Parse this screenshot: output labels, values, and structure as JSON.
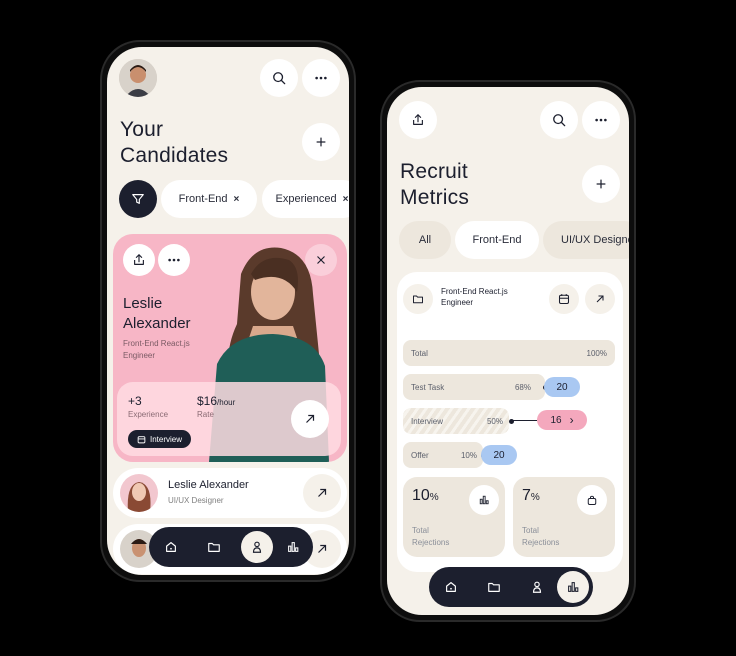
{
  "left": {
    "title_line1": "Your",
    "title_line2": "Candidates",
    "filters": [
      {
        "label": "Front-End",
        "close": "×"
      },
      {
        "label": "Experienced",
        "close": "×"
      }
    ],
    "featured": {
      "name_line1": "Leslie",
      "name_line2": "Alexander",
      "role_line1": "Front-End React.js",
      "role_line2": "Engineer",
      "experience_value": "+3",
      "experience_label": "Experience",
      "rate_value": "$16",
      "rate_unit": "/hour",
      "rate_label": "Rate",
      "status": "Interview"
    },
    "list": [
      {
        "name": "Leslie Alexander",
        "role": "UI/UX Designer"
      }
    ]
  },
  "right": {
    "title_line1": "Recruit",
    "title_line2": "Metrics",
    "tabs": [
      "All",
      "Front-End",
      "UI/UX Designer"
    ],
    "job_title_line1": "Front-End React.js",
    "job_title_line2": "Engineer",
    "funnel": [
      {
        "label": "Total",
        "percent": "100%",
        "count": ""
      },
      {
        "label": "Test Task",
        "percent": "68%",
        "count": "20"
      },
      {
        "label": "Interview",
        "percent": "50%",
        "count": "16",
        "arrow": "›"
      },
      {
        "label": "Offer",
        "percent": "10%",
        "count": "20"
      }
    ],
    "rejections": [
      {
        "value": "10",
        "unit": "%",
        "label_line1": "Total",
        "label_line2": "Rejections"
      },
      {
        "value": "7",
        "unit": "%",
        "label_line1": "Total",
        "label_line2": "Rejections"
      }
    ]
  },
  "colors": {
    "background": "#000000",
    "screen": "#f5f1ea",
    "dark_navy": "#1c1f2e",
    "pink_card": "#f7b6c6",
    "bubble_blue": "#a9c8f2",
    "bubble_pink": "#f4a8bd"
  },
  "icons": [
    "search-icon",
    "more-icon",
    "plus-icon",
    "filter-icon",
    "share-icon",
    "close-icon",
    "arrow-up-right-icon",
    "calendar-icon",
    "folder-icon",
    "home-icon",
    "user-icon",
    "bar-chart-icon",
    "bag-icon"
  ]
}
